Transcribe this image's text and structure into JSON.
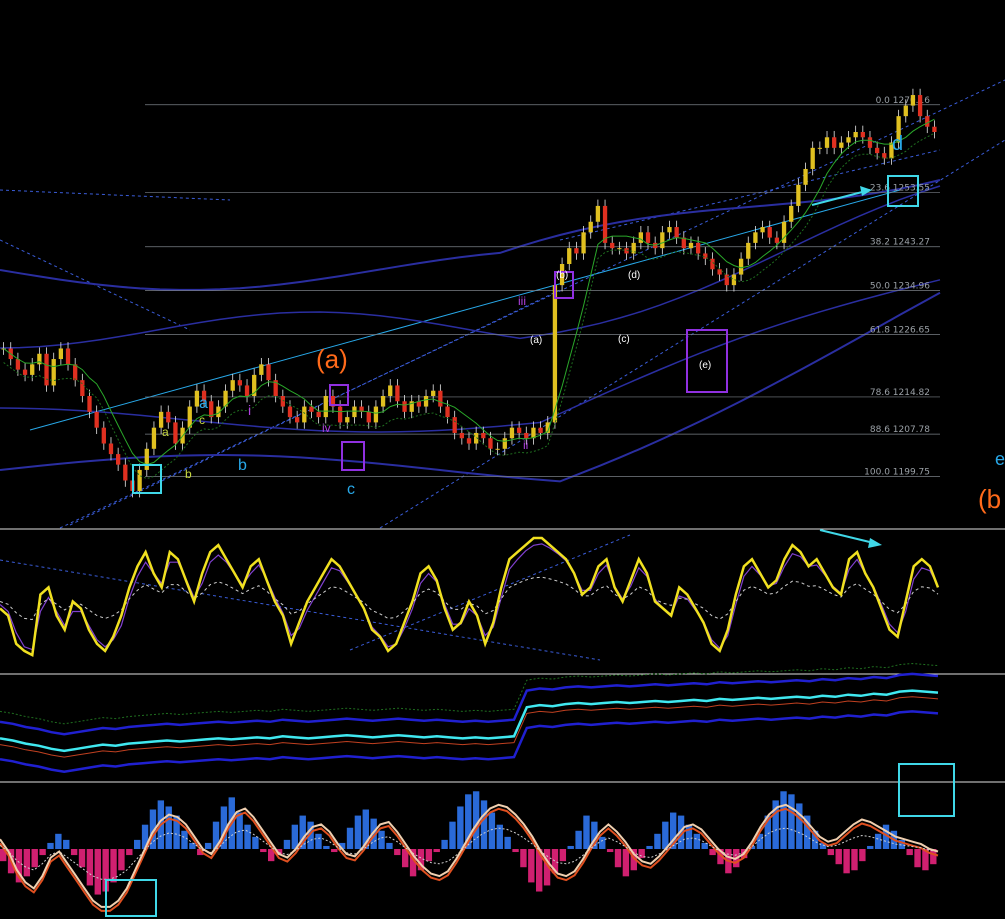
{
  "chart_data": {
    "type": "candlestick",
    "title": "",
    "price_panel": {
      "y_range": [
        1190,
        1290
      ],
      "fib_levels": [
        {
          "label": "0.0 1270.16",
          "value": 1270.16
        },
        {
          "label": "23.6 1253.55",
          "value": 1253.55
        },
        {
          "label": "38.2 1243.27",
          "value": 1243.27
        },
        {
          "label": "50.0 1234.96",
          "value": 1234.96
        },
        {
          "label": "61.8 1226.65",
          "value": 1226.65
        },
        {
          "label": "78.6 1214.82",
          "value": 1214.82
        },
        {
          "label": "88.6 1207.78",
          "value": 1207.78
        },
        {
          "label": "100.0 1199.75",
          "value": 1199.75
        }
      ],
      "close_series": [
        1224,
        1222,
        1220,
        1219,
        1221,
        1223,
        1217,
        1222,
        1224,
        1221,
        1218,
        1215,
        1212,
        1209,
        1206,
        1204,
        1202,
        1199,
        1197,
        1201,
        1205,
        1209,
        1212,
        1210,
        1206,
        1209,
        1213,
        1216,
        1214,
        1211,
        1213,
        1216,
        1218,
        1217,
        1215,
        1219,
        1221,
        1218,
        1215,
        1213,
        1211,
        1210,
        1213,
        1212,
        1211,
        1215,
        1213,
        1210,
        1211,
        1213,
        1212,
        1210,
        1213,
        1215,
        1217,
        1214,
        1212,
        1214,
        1213,
        1215,
        1216,
        1213,
        1211,
        1208,
        1207,
        1206,
        1208,
        1207,
        1205,
        1205,
        1207,
        1209,
        1208,
        1207,
        1209,
        1208,
        1210,
        1236,
        1240,
        1243,
        1242,
        1246,
        1248,
        1251,
        1244,
        1243,
        1243,
        1242,
        1244,
        1246,
        1244,
        1243,
        1246,
        1247,
        1245,
        1243,
        1244,
        1242,
        1241,
        1239,
        1238,
        1236,
        1238,
        1241,
        1244,
        1246,
        1247,
        1245,
        1244,
        1248,
        1251,
        1255,
        1258,
        1262,
        1262,
        1264,
        1262,
        1263,
        1264,
        1265,
        1264,
        1262,
        1261,
        1260,
        1263,
        1268,
        1270,
        1272,
        1268,
        1266,
        1265
      ],
      "wave_labels": [
        {
          "text": "(a)",
          "color": "#ff6a1a"
        },
        {
          "text": "(b",
          "color": "#ff6a1a"
        },
        {
          "text": "d",
          "color": "#28a8e8"
        },
        {
          "text": "e",
          "color": "#28a8e8"
        },
        {
          "text": "a",
          "color": "#28a8e8"
        },
        {
          "text": "b",
          "color": "#28a8e8"
        },
        {
          "text": "c",
          "color": "#28a8e8"
        },
        {
          "text": "i",
          "color": "#b040e0"
        },
        {
          "text": "ii",
          "color": "#b040e0"
        },
        {
          "text": "iii",
          "color": "#b040e0"
        },
        {
          "text": "iv",
          "color": "#b040e0"
        },
        {
          "text": "(a)",
          "color": "#ffffff"
        },
        {
          "text": "(b)",
          "color": "#ffffff"
        },
        {
          "text": "(c)",
          "color": "#ffffff"
        },
        {
          "text": "(d)",
          "color": "#ffffff"
        },
        {
          "text": "(e)",
          "color": "#ffffff"
        },
        {
          "text": "a",
          "color": "#c8d840"
        },
        {
          "text": "b",
          "color": "#c8d840"
        },
        {
          "text": "c",
          "color": "#c8d840"
        }
      ]
    },
    "oscillator_panel": {
      "y_range": [
        0,
        100
      ],
      "main_series": [
        45,
        40,
        20,
        15,
        12,
        55,
        60,
        40,
        30,
        50,
        45,
        30,
        20,
        15,
        25,
        40,
        60,
        75,
        85,
        70,
        60,
        85,
        80,
        65,
        50,
        70,
        85,
        90,
        80,
        70,
        60,
        75,
        80,
        65,
        50,
        40,
        20,
        35,
        50,
        60,
        70,
        80,
        75,
        65,
        55,
        45,
        30,
        25,
        15,
        20,
        35,
        50,
        70,
        75,
        65,
        45,
        30,
        35,
        50,
        40,
        20,
        35,
        60,
        80,
        85,
        90,
        95,
        95,
        90,
        85,
        80,
        70,
        55,
        60,
        75,
        80,
        60,
        50,
        65,
        80,
        70,
        50,
        45,
        40,
        60,
        55,
        45,
        35,
        20,
        15,
        30,
        55,
        75,
        80,
        70,
        60,
        65,
        80,
        90,
        85,
        75,
        80,
        70,
        60,
        55,
        80,
        85,
        70,
        60,
        45,
        30,
        25,
        50,
        75,
        80,
        75,
        60
      ],
      "signal_series": [
        50,
        45,
        30,
        20,
        18,
        45,
        55,
        45,
        35,
        45,
        45,
        35,
        25,
        20,
        25,
        35,
        55,
        70,
        80,
        72,
        65,
        80,
        80,
        68,
        55,
        65,
        80,
        85,
        80,
        72,
        64,
        72,
        78,
        68,
        55,
        44,
        28,
        33,
        46,
        56,
        66,
        76,
        74,
        66,
        57,
        48,
        34,
        28,
        20,
        22,
        33,
        47,
        65,
        72,
        66,
        50,
        36,
        36,
        47,
        42,
        28,
        34,
        55,
        75,
        82,
        88,
        92,
        93,
        90,
        86,
        81,
        72,
        60,
        60,
        72,
        78,
        63,
        54,
        63,
        76,
        70,
        54,
        47,
        43,
        56,
        54,
        46,
        38,
        25,
        19,
        28,
        50,
        70,
        77,
        71,
        63,
        65,
        77,
        86,
        84,
        77,
        78,
        71,
        63,
        58,
        75,
        82,
        72,
        63,
        50,
        36,
        30,
        45,
        68,
        76,
        74,
        63
      ]
    },
    "indicator_panel": {
      "y_range": [
        0,
        100
      ],
      "cyan_series": [
        40,
        38,
        35,
        33,
        30,
        28,
        30,
        32,
        34,
        33,
        35,
        36,
        37,
        38,
        37,
        38,
        39,
        40,
        39,
        40,
        41,
        40,
        42,
        41,
        40,
        41,
        42,
        43,
        42,
        41,
        42,
        43,
        42,
        41,
        42,
        41,
        40,
        41,
        40,
        41,
        42,
        70,
        72,
        71,
        73,
        74,
        73,
        74,
        75,
        74,
        75,
        76,
        75,
        76,
        77,
        76,
        78,
        77,
        78,
        79,
        78,
        79,
        80,
        79,
        81,
        80,
        82,
        81,
        83,
        82,
        85,
        86,
        85,
        84
      ]
    },
    "histogram_panel": {
      "y_range": [
        -100,
        100
      ],
      "histogram": [
        -20,
        -40,
        -55,
        -45,
        -30,
        -10,
        10,
        25,
        15,
        -10,
        -30,
        -60,
        -75,
        -70,
        -55,
        -35,
        -10,
        15,
        40,
        65,
        80,
        70,
        55,
        30,
        10,
        -10,
        10,
        45,
        70,
        85,
        60,
        40,
        20,
        -5,
        -20,
        -10,
        15,
        40,
        55,
        45,
        25,
        5,
        -5,
        10,
        35,
        55,
        65,
        50,
        30,
        10,
        -10,
        -30,
        -45,
        -35,
        -20,
        -5,
        15,
        45,
        70,
        90,
        95,
        80,
        60,
        40,
        20,
        -5,
        -30,
        -55,
        -70,
        -60,
        -40,
        -20,
        5,
        30,
        55,
        45,
        20,
        -5,
        -30,
        -45,
        -35,
        -15,
        5,
        25,
        45,
        60,
        55,
        40,
        25,
        10,
        -10,
        -25,
        -40,
        -30,
        -15,
        5,
        25,
        55,
        80,
        95,
        90,
        75,
        55,
        30,
        10,
        -10,
        -25,
        -40,
        -35,
        -20,
        5,
        25,
        40,
        30,
        15,
        -10,
        -30,
        -35,
        -25
      ],
      "line_series": [
        60,
        50,
        35,
        25,
        20,
        30,
        45,
        50,
        40,
        30,
        20,
        10,
        5,
        5,
        10,
        20,
        35,
        50,
        65,
        75,
        80,
        78,
        72,
        62,
        52,
        48,
        58,
        72,
        82,
        85,
        78,
        68,
        58,
        48,
        45,
        52,
        62,
        70,
        72,
        66,
        56,
        48,
        46,
        54,
        64,
        72,
        74,
        66,
        56,
        46,
        38,
        32,
        30,
        34,
        44,
        56,
        68,
        78,
        85,
        88,
        86,
        80,
        72,
        62,
        50,
        40,
        32,
        30,
        34,
        44,
        56,
        66,
        72,
        66,
        58,
        48,
        42,
        40,
        46,
        54,
        62,
        70,
        72,
        68,
        60,
        52,
        46,
        44,
        48,
        58,
        70,
        80,
        86,
        88,
        84,
        78,
        70,
        62,
        58,
        60,
        66,
        72,
        76,
        74,
        70,
        66,
        62,
        60,
        58,
        56,
        52,
        50
      ]
    }
  }
}
